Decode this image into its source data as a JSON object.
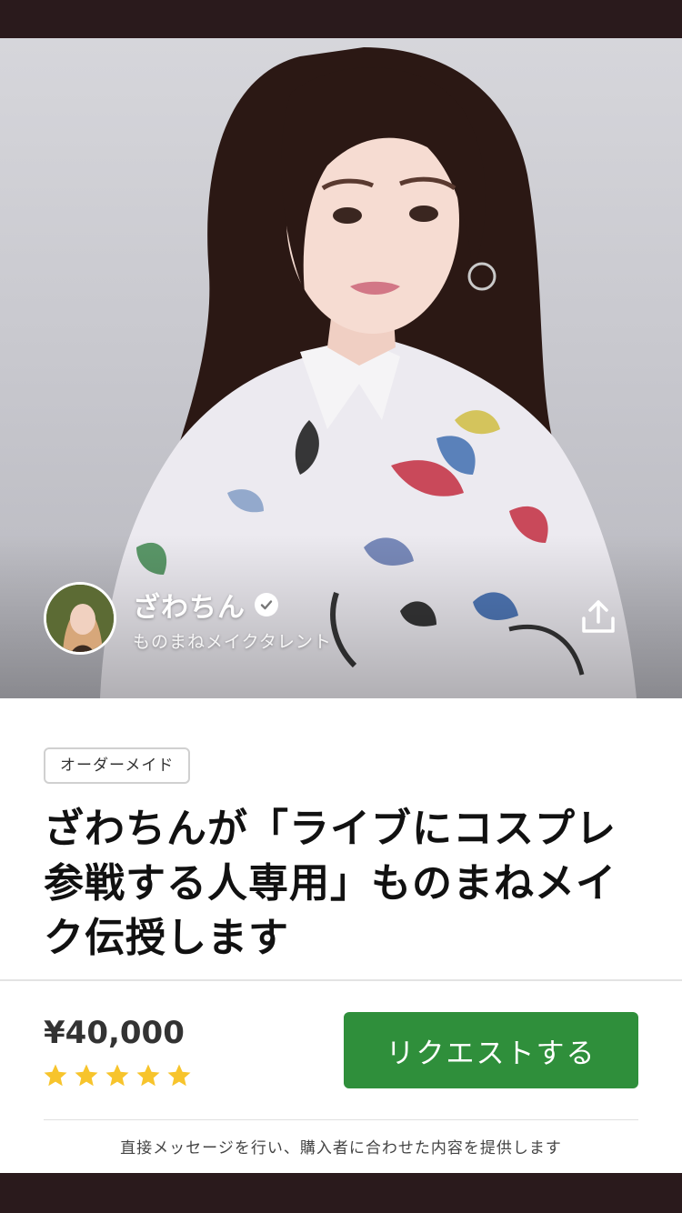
{
  "hero": {
    "creator_name": "ざわちん",
    "creator_subtitle": "ものまねメイクタレント",
    "icons": {
      "verified": "verified-check-icon",
      "share": "share-icon"
    }
  },
  "product": {
    "tag": "オーダーメイド",
    "title": "ざわちんが「ライブにコスプレ参戦する人専用」ものまねメイク伝授します",
    "price": "¥40,000",
    "rating": 5,
    "rating_max": 5,
    "request_button": "リクエストする",
    "footnote": "直接メッセージを行い、購入者に合わせた内容を提供します"
  },
  "colors": {
    "status_bar": "#2a1a1c",
    "button_green": "#2f8f3b",
    "star_yellow": "#f7c42c"
  }
}
